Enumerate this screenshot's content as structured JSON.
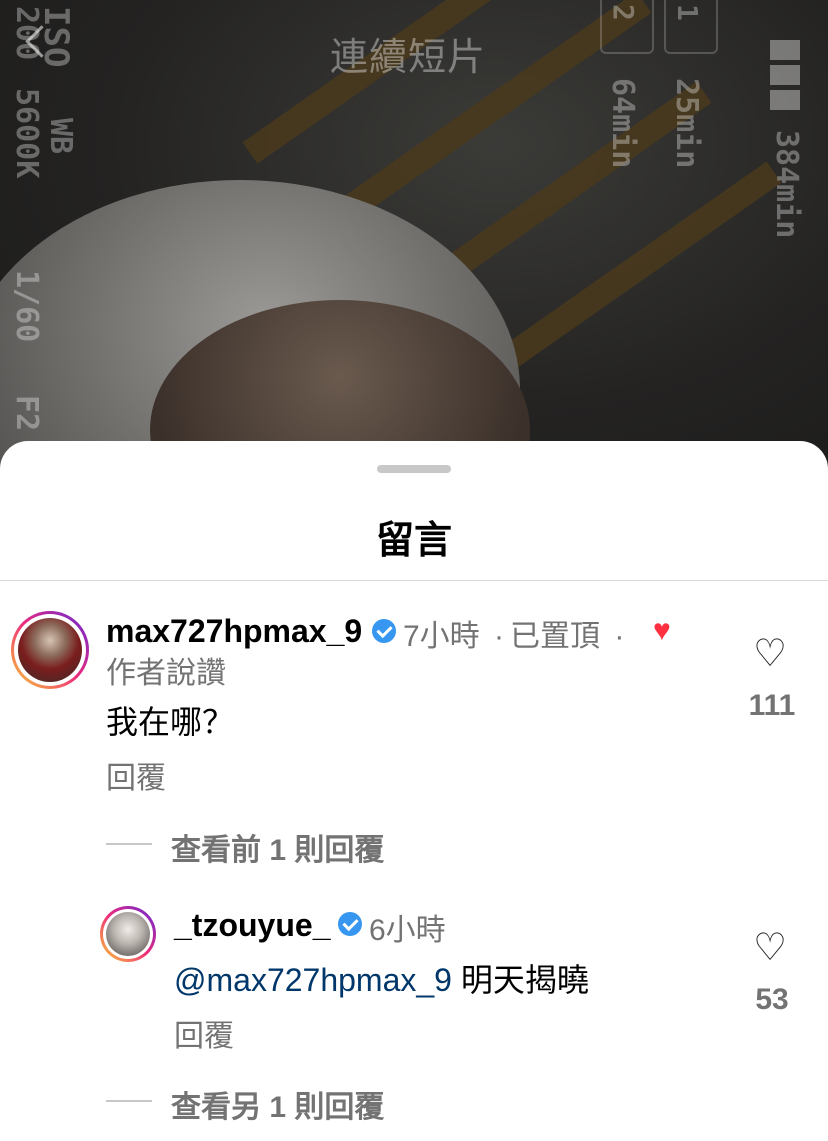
{
  "background": {
    "title": "連續短片",
    "osd": {
      "iso": "ISO",
      "iso_value": "200",
      "wb_label": "WB",
      "wb_value": "5600K",
      "shutter": "1/60",
      "aperture": "F2",
      "slot_1": "1",
      "slot_2": "2",
      "time_1": "25min",
      "time_2": "64min",
      "time_total": "384min"
    }
  },
  "sheet": {
    "title": "留言"
  },
  "comments": [
    {
      "username": "max727hpmax_9",
      "verified": true,
      "time": "7小時",
      "pinned_label": "已置頂",
      "separator": "·",
      "creator_like_label": "作者說讚",
      "text": "我在哪？",
      "reply_label": "回覆",
      "likes": "111",
      "view_replies": "查看前 1 則回覆"
    },
    {
      "username": "_tzouyue_",
      "verified": true,
      "time": "6小時",
      "mention": "@max727hpmax_9",
      "text": " 明天揭曉",
      "reply_label": "回覆",
      "likes": "53",
      "view_replies": "查看另 1 則回覆"
    }
  ],
  "colors": {
    "verified": "#3797f0",
    "creator_heart": "#ff3040",
    "mention": "#00376b",
    "secondary_text": "#737373"
  },
  "icons": {
    "back": "chevron-left-icon",
    "verified": "verified-badge-icon",
    "like": "heart-outline-icon",
    "creator_like": "heart-filled-icon"
  }
}
